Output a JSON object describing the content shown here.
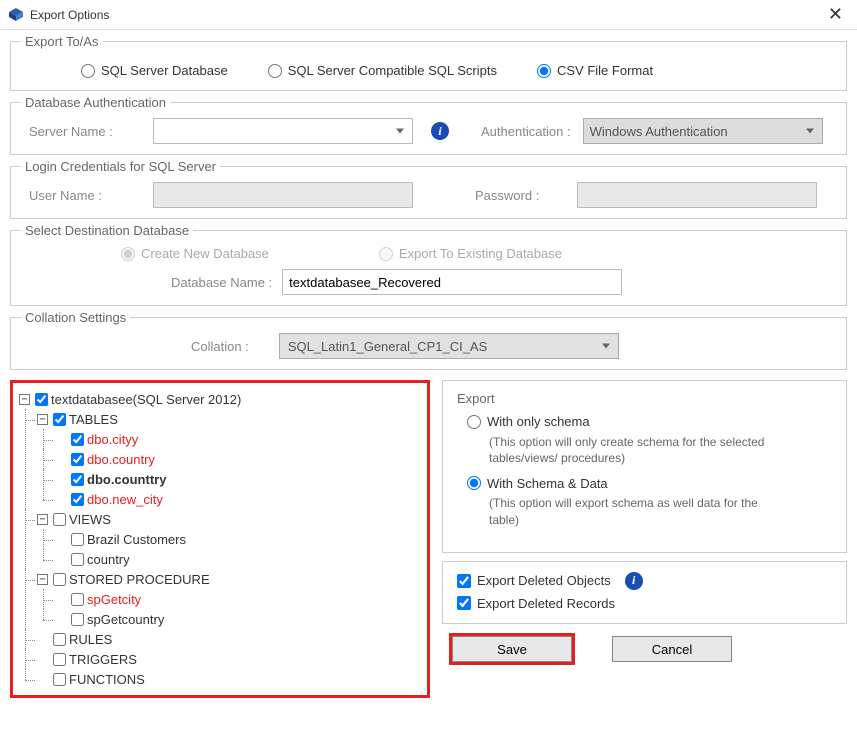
{
  "window": {
    "title": "Export Options"
  },
  "exportToAs": {
    "legend": "Export To/As",
    "opt1": "SQL Server Database",
    "opt2": "SQL Server Compatible SQL Scripts",
    "opt3": "CSV File Format",
    "selected": "opt3"
  },
  "dbAuth": {
    "legend": "Database Authentication",
    "serverLabel": "Server Name :",
    "authLabel": "Authentication :",
    "authValue": "Windows Authentication"
  },
  "login": {
    "legend": "Login Credentials for SQL Server",
    "userLabel": "User Name :",
    "passLabel": "Password :"
  },
  "dest": {
    "legend": "Select Destination Database",
    "create": "Create New Database",
    "existing": "Export To Existing Database",
    "dbNameLabel": "Database Name :",
    "dbNameValue": "textdatabasee_Recovered"
  },
  "collation": {
    "legend": "Collation Settings",
    "label": "Collation :",
    "value": "SQL_Latin1_General_CP1_CI_AS"
  },
  "tree": {
    "root": "textdatabasee(SQL Server 2012)",
    "tables": "TABLES",
    "t1": "dbo.cityy",
    "t2": "dbo.country",
    "t3": "dbo.counttry",
    "t4": "dbo.new_city",
    "views": "VIEWS",
    "v1": "Brazil Customers",
    "v2": "country",
    "sp": "STORED PROCEDURE",
    "sp1": "spGetcity",
    "sp2": "spGetcountry",
    "rules": "RULES",
    "triggers": "TRIGGERS",
    "functions": "FUNCTIONS"
  },
  "export": {
    "header": "Export",
    "schemaOnly": "With only schema",
    "schemaOnlyDesc": "(This option will only create schema for the  selected tables/views/ procedures)",
    "schemaData": "With Schema & Data",
    "schemaDataDesc": "(This option will export schema as well data for the table)",
    "deletedObjects": "Export Deleted Objects",
    "deletedRecords": "Export Deleted Records"
  },
  "buttons": {
    "save": "Save",
    "cancel": "Cancel"
  }
}
